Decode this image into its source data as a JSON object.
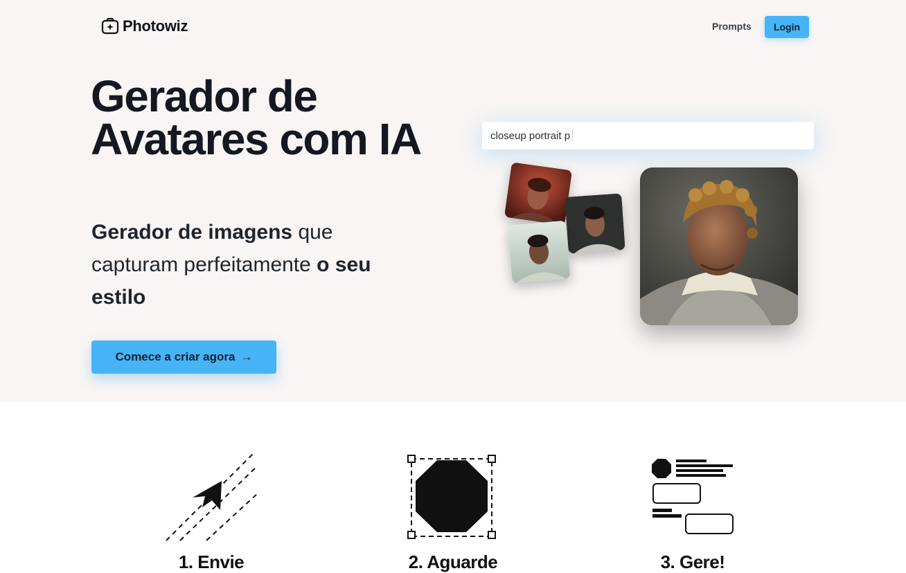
{
  "nav": {
    "brand": "Photowiz",
    "logo_icon": "sparkle-image-icon",
    "links": [
      {
        "label": "Prompts"
      }
    ],
    "login_label": "Login"
  },
  "hero": {
    "headline": "Gerador de Avatares com IA",
    "subline_bold_1": "Gerador de imagens",
    "subline_text_1": " que capturam perfeitamente ",
    "subline_bold_2": "o seu estilo",
    "cta_label": "Comece a criar agora",
    "cta_icon": "arrow-right-icon",
    "prompt_value": "closeup portrait p"
  },
  "steps": [
    {
      "title": "1. Envie",
      "icon": "paper-plane-icon"
    },
    {
      "title": "2. Aguarde",
      "icon": "octagon-selection-icon"
    },
    {
      "title": "3. Gere!",
      "icon": "layout-wireframe-icon"
    }
  ],
  "colors": {
    "accent": "#46b4f6",
    "hero_bg": "#f8f5f4",
    "text": "#151821"
  }
}
